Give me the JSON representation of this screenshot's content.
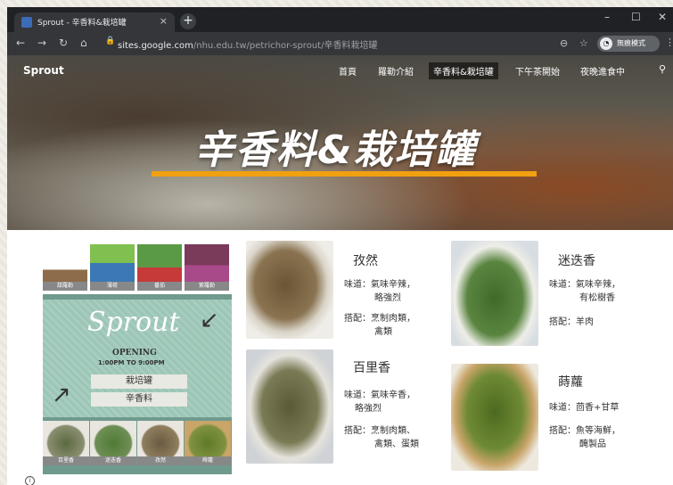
{
  "browser": {
    "tab_title": "Sprout - 辛香料&栽培罐",
    "tab_close": "×",
    "new_tab": "+",
    "url_domain": "sites.google.com",
    "url_path": "/nhu.edu.tw/petrichor-sprout/辛香料栽培罐",
    "incognito_label": "無痕模式",
    "controls": {
      "min": "–",
      "max": "☐",
      "close": "✕"
    }
  },
  "site": {
    "brand": "Sprout",
    "nav": [
      "首頁",
      "羅勒介紹",
      "辛香料&栽培罐",
      "下午茶開始",
      "夜晚進食中"
    ],
    "active_nav": "辛香料&栽培罐",
    "hero_title": "辛香料&栽培罐"
  },
  "poster": {
    "top_labels": [
      "甜羅勒",
      "薄荷",
      "番茄",
      "紫羅勒"
    ],
    "logo": "Sprout",
    "opening": "OPENING",
    "hours": "1:00PM TO 9:00PM",
    "buttons": [
      "栽培罐",
      "辛香料"
    ],
    "bottom_labels": [
      "百里香",
      "迷迭香",
      "孜然",
      "蒔蘿"
    ]
  },
  "spices": [
    {
      "name": "孜然",
      "taste": "味道：氣味辛辣，",
      "taste2": "略強烈",
      "pair": "搭配：烹制肉類，",
      "pair2": "禽類"
    },
    {
      "name": "百里香",
      "taste": "味道：氣味辛香，",
      "taste2": "略強烈",
      "pair": "搭配：烹制肉類、",
      "pair2": "禽類、蛋類"
    },
    {
      "name": "迷迭香",
      "taste": "味道：氣味辛辣，",
      "taste2": "有松樹香",
      "pair": "搭配：羊肉",
      "pair2": ""
    },
    {
      "name": "蒔蘿",
      "taste": "味道：茴香+甘草",
      "taste2": "",
      "pair": "搭配：魚等海鮮，",
      "pair2": "醃製品"
    }
  ],
  "colors": {
    "accent": "#f0a010",
    "chrome_dark": "#202124",
    "chrome_bar": "#35363a"
  }
}
